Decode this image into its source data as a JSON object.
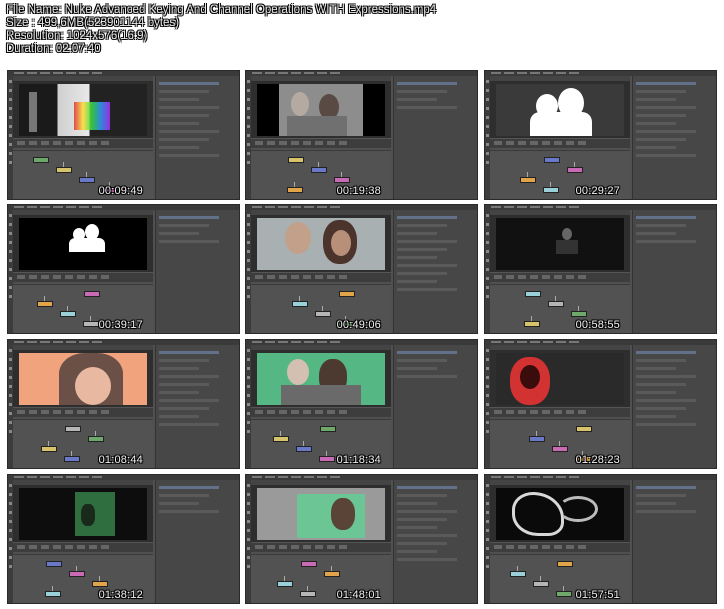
{
  "info": {
    "file_name": "File Name: Nuke Advanced Keying And Channel Operations WITH Expressions.mp4",
    "size": "Size : 499,6MB(523901144 bytes)",
    "resolution": "Resolution: 1024x576(16:9)",
    "duration": "Duration: 02:07:40"
  },
  "thumbnails": [
    {
      "timecode": "00:09:49",
      "scene": "color-charts"
    },
    {
      "timecode": "00:19:38",
      "scene": "grey-couple"
    },
    {
      "timecode": "00:29:27",
      "scene": "matte-white"
    },
    {
      "timecode": "00:39:17",
      "scene": "matte-small"
    },
    {
      "timecode": "00:49:06",
      "scene": "couple-large"
    },
    {
      "timecode": "00:58:55",
      "scene": "dark-nodes"
    },
    {
      "timecode": "01:08:44",
      "scene": "orange-face"
    },
    {
      "timecode": "01:18:34",
      "scene": "green-couple"
    },
    {
      "timecode": "01:28:23",
      "scene": "red-face"
    },
    {
      "timecode": "01:38:12",
      "scene": "dark-green"
    },
    {
      "timecode": "01:48:01",
      "scene": "green-frame"
    },
    {
      "timecode": "01:57:51",
      "scene": "outline-matte"
    }
  ]
}
